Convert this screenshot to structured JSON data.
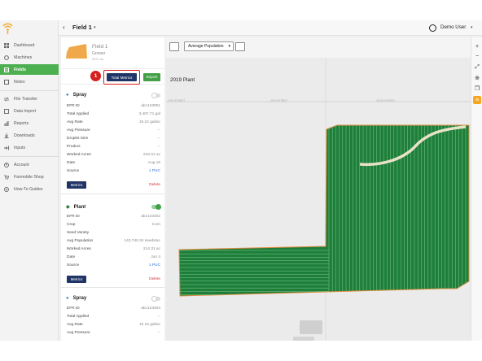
{
  "topbar": {
    "back": "‹",
    "field_title": "Field 1",
    "caret": "▾",
    "user_name": "Demo User",
    "user_caret": "▾"
  },
  "sidebar": {
    "items": [
      {
        "label": "Dashboard",
        "icon": "dashboard-icon"
      },
      {
        "label": "Machines",
        "icon": "machine-icon"
      },
      {
        "label": "Fields",
        "icon": "fields-icon",
        "active": true
      },
      {
        "label": "Notes",
        "icon": "notes-icon"
      },
      {
        "label": "File Transfer",
        "icon": "transfer-icon"
      },
      {
        "label": "Data Import",
        "icon": "import-icon"
      },
      {
        "label": "Reports",
        "icon": "reports-icon"
      },
      {
        "label": "Downloads",
        "icon": "download-icon"
      },
      {
        "label": "Inputs",
        "icon": "inputs-icon"
      },
      {
        "label": "Account",
        "icon": "account-icon"
      },
      {
        "label": "Farmobile Shop",
        "icon": "shop-icon"
      },
      {
        "label": "How-To Guides",
        "icon": "guide-icon"
      }
    ]
  },
  "field": {
    "name": "Field 1",
    "grower": "Grower",
    "acres": "2571 ac"
  },
  "toolbar": {
    "step_number": "1",
    "total_metrics": "Total Metrics",
    "export": "Export"
  },
  "spray1": {
    "title": "Spray",
    "rows": [
      {
        "k": "EFR ID",
        "v": "abc123001"
      },
      {
        "k": "Total Applied",
        "v": "3,487.71 gal"
      },
      {
        "k": "Avg Rate",
        "v": "16.22 gal/ac"
      },
      {
        "k": "Avg Pressure",
        "v": "--"
      },
      {
        "k": "Droplet Size",
        "v": "--"
      },
      {
        "k": "Product",
        "v": "--"
      },
      {
        "k": "Worked Acres",
        "v": "215.01 ac"
      },
      {
        "k": "Date",
        "v": "Aug 15"
      },
      {
        "k": "Source",
        "v": "1 PUC"
      }
    ],
    "metrics": "Metrics",
    "delete": "Delete"
  },
  "plant": {
    "title": "Plant",
    "rows": [
      {
        "k": "EFR ID",
        "v": "abc123402"
      },
      {
        "k": "Crop",
        "v": "Corn"
      },
      {
        "k": "Seed Variety",
        "v": ""
      },
      {
        "k": "Avg Population",
        "v": "143,740.34 seeds/ac"
      },
      {
        "k": "Worked Acres",
        "v": "214.31 ac"
      },
      {
        "k": "Date",
        "v": "Jun 4"
      },
      {
        "k": "Source",
        "v": "1 PUC"
      }
    ],
    "metrics": "Metrics",
    "delete": "Delete"
  },
  "spray2": {
    "title": "Spray",
    "rows": [
      {
        "k": "EFR ID",
        "v": "abc123403"
      },
      {
        "k": "Total Applied",
        "v": "--"
      },
      {
        "k": "Avg Rate",
        "v": "10.15 gal/ac"
      },
      {
        "k": "Avg Pressure",
        "v": "--"
      }
    ]
  },
  "map": {
    "layer": "Average Population",
    "layer_caret": "▾",
    "label": "2019 Plant",
    "roads": [
      "20TH STREET",
      "20TH STREET",
      "200TH STREET"
    ],
    "colors": {
      "crop": "#1e7f3a",
      "row_line": "#9fd6a8",
      "boundary": "#e08a3c",
      "brand": "#f5a623",
      "primary": "#1f3566",
      "green": "#43a047"
    }
  },
  "controls": {
    "zoom_in": "+",
    "zoom_out": "−"
  }
}
